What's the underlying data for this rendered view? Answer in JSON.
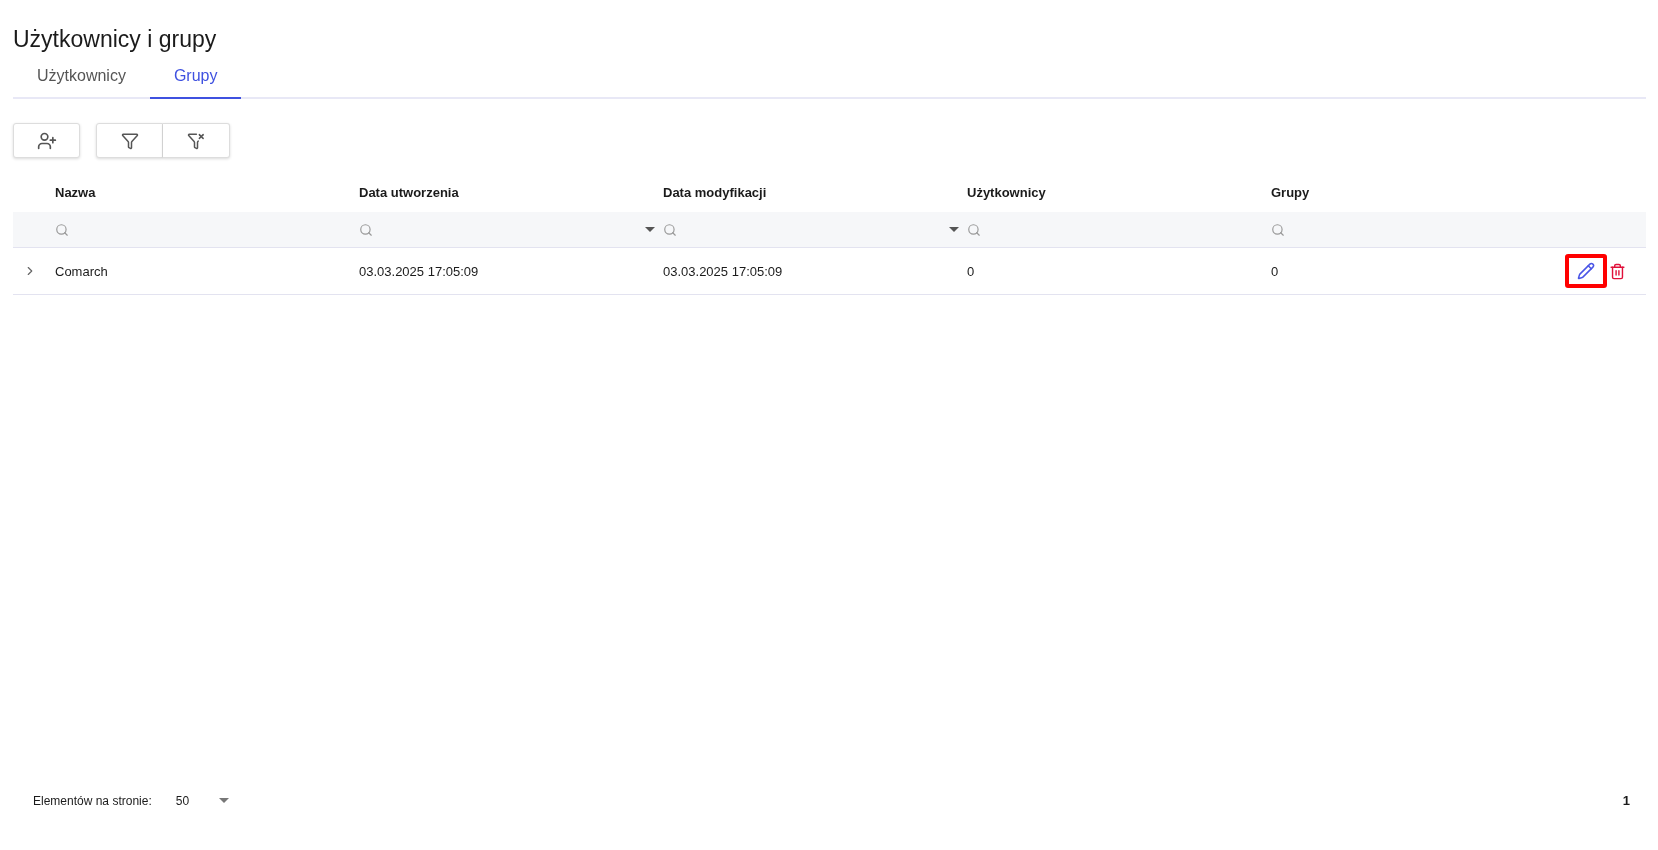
{
  "title": "Użytkownicy i grupy",
  "tabs": [
    {
      "label": "Użytkownicy",
      "selected": false
    },
    {
      "label": "Grupy",
      "selected": true
    }
  ],
  "table": {
    "columns": [
      {
        "label": "Nazwa",
        "filter_dropdown": false
      },
      {
        "label": "Data utworzenia",
        "filter_dropdown": true
      },
      {
        "label": "Data modyfikacji",
        "filter_dropdown": true
      },
      {
        "label": "Użytkownicy",
        "filter_dropdown": false
      },
      {
        "label": "Grupy",
        "filter_dropdown": false
      }
    ],
    "rows": [
      {
        "expanded": false,
        "cells": [
          "Comarch",
          "03.03.2025 17:05:09",
          "03.03.2025 17:05:09",
          "0",
          "0"
        ],
        "edit_highlighted": true
      }
    ]
  },
  "footer": {
    "page_size_label": "Elementów na stronie:",
    "page_size": "50",
    "page": "1"
  }
}
